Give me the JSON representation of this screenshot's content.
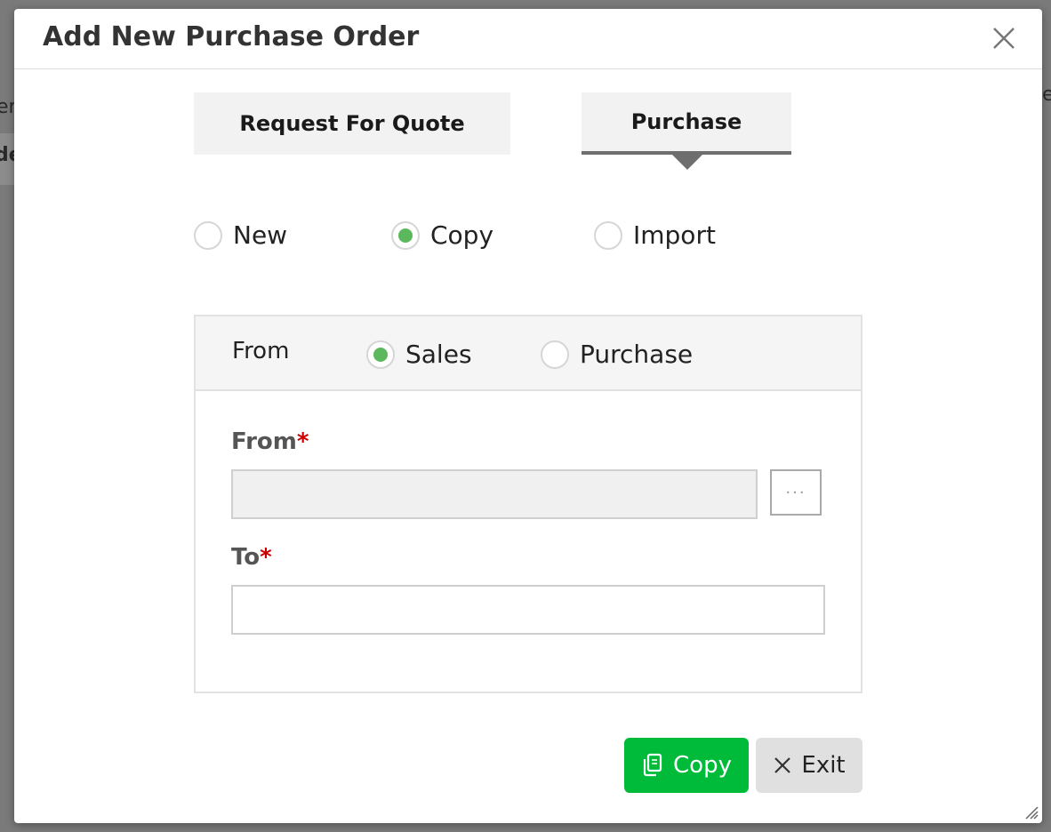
{
  "dialog": {
    "title": "Add New Purchase Order",
    "close_icon": "close-icon"
  },
  "tabs": [
    {
      "label": "Request For Quote",
      "active": false
    },
    {
      "label": "Purchase",
      "active": true
    }
  ],
  "mode_options": [
    {
      "label": "New",
      "checked": false
    },
    {
      "label": "Copy",
      "checked": true
    },
    {
      "label": "Import",
      "checked": false
    }
  ],
  "source_panel": {
    "header_label": "From",
    "source_options": [
      {
        "label": "Sales",
        "checked": true
      },
      {
        "label": "Purchase",
        "checked": false
      }
    ],
    "from_field": {
      "label": "From",
      "required_marker": "*",
      "value": "",
      "placeholder": ""
    },
    "browse_button_label": "···",
    "to_field": {
      "label": "To",
      "required_marker": "*",
      "value": "",
      "placeholder": ""
    }
  },
  "footer": {
    "copy_label": "Copy",
    "copy_icon": "copy-icon",
    "exit_label": "Exit",
    "exit_icon": "close-icon"
  },
  "background_fragments": [
    "er",
    "de",
    "e"
  ],
  "colors": {
    "accent_green": "#00bb3a",
    "radio_checked": "#5cb85c",
    "required": "#cc0000"
  }
}
